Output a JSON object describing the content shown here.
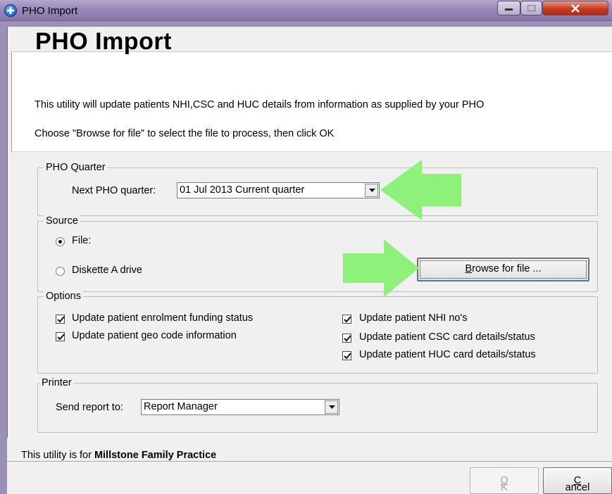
{
  "window": {
    "title": "PHO Import"
  },
  "header": {
    "title": "PHO Import",
    "description_line1": "This utility will update patients NHI,CSC and HUC details from information as supplied by your PHO",
    "description_line2": "Choose \"Browse for file\" to select the file to process, then click OK"
  },
  "quarter_group": {
    "legend": "PHO Quarter",
    "label": "Next PHO quarter:",
    "selected": "01 Jul 2013 Current quarter"
  },
  "source_group": {
    "legend": "Source",
    "options": [
      {
        "label": "File:",
        "selected": true
      },
      {
        "label": "Diskette A drive",
        "selected": false
      }
    ],
    "browse_button": {
      "prefix": "",
      "accel": "B",
      "rest": "rowse for file ..."
    }
  },
  "options_group": {
    "legend": "Options",
    "items": [
      {
        "label": "Update patient enrolment funding status",
        "checked": true
      },
      {
        "label": "Update patient geo code information",
        "checked": true
      },
      {
        "label": "Update patient NHI no's",
        "checked": true
      },
      {
        "label": "Update patient CSC card details/status",
        "checked": true
      },
      {
        "label": "Update patient HUC card details/status",
        "checked": true
      }
    ]
  },
  "printer_group": {
    "legend": "Printer",
    "label": "Send report to:",
    "selected": "Report Manager"
  },
  "footer": {
    "note_prefix": "This utility is for",
    "practice_name": "Millstone Family Practice"
  },
  "buttons": {
    "ok": {
      "accel": "O",
      "rest": "K"
    },
    "cancel": {
      "accel": "C",
      "rest": "ancel"
    }
  },
  "colors": {
    "arrow": "#8ef27a",
    "titlebar": "#9a8cba",
    "close": "#c63c22"
  }
}
